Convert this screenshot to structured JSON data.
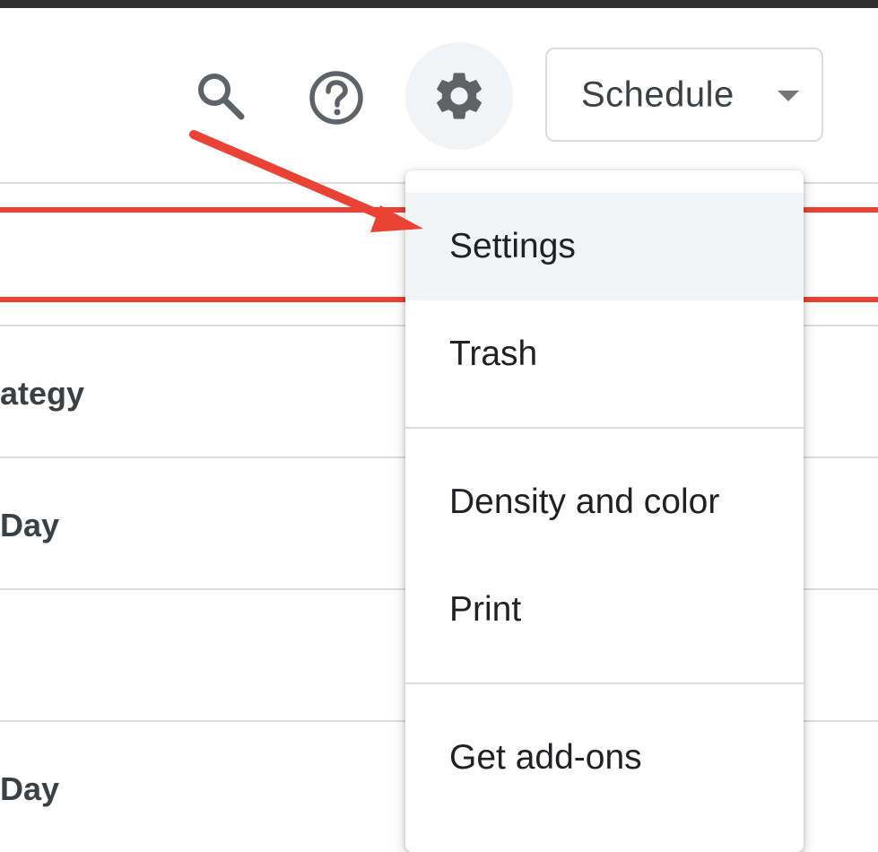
{
  "toolbar": {
    "search_icon": "search-icon",
    "help_icon": "help-icon",
    "settings_icon": "gear-icon",
    "view_selector": {
      "label": "Schedule",
      "icon": "caret-down-icon"
    }
  },
  "rows": [
    {
      "label": "ategy"
    },
    {
      "label": "Day"
    },
    {
      "label": ""
    },
    {
      "label": "Day"
    }
  ],
  "menu": {
    "items": [
      {
        "label": "Settings",
        "highlighted": true
      },
      {
        "label": "Trash"
      },
      {
        "label": "Density and color"
      },
      {
        "label": "Print"
      },
      {
        "label": "Get add-ons"
      }
    ]
  },
  "annotation": {
    "color": "#ea4335",
    "type": "arrow"
  },
  "colors": {
    "accent": "#ea4335",
    "hover_bg": "#f1f3f4",
    "border": "#dadce0",
    "text": "#3c4043"
  }
}
